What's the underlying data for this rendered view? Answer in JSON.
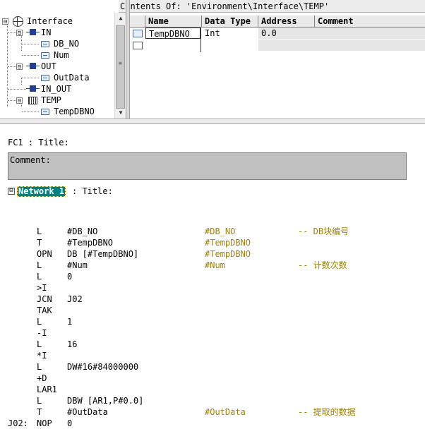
{
  "interface_tree": {
    "root": {
      "label": "Interface",
      "expander": "⊟",
      "icon": "globe-icon"
    },
    "items": [
      {
        "label": "IN",
        "expander": "⊟",
        "icon": "in-param-icon",
        "level": 1
      },
      {
        "label": "DB_NO",
        "icon": "variable-icon",
        "level": 2
      },
      {
        "label": "Num",
        "icon": "variable-icon",
        "level": 2
      },
      {
        "label": "OUT",
        "expander": "⊟",
        "icon": "out-param-icon",
        "level": 1
      },
      {
        "label": "OutData",
        "icon": "variable-icon",
        "level": 2
      },
      {
        "label": "IN_OUT",
        "icon": "inout-param-icon",
        "level": 1
      },
      {
        "label": "TEMP",
        "expander": "⊟",
        "icon": "temp-icon",
        "level": 1
      },
      {
        "label": "TempDBNO",
        "icon": "variable-icon",
        "level": 2
      }
    ]
  },
  "contents_title": "Contents Of: 'Environment\\Interface\\TEMP'",
  "var_table": {
    "headers": {
      "name": "Name",
      "data_type": "Data Type",
      "address": "Address",
      "comment": "Comment"
    },
    "rows": [
      {
        "name": "TempDBNO",
        "data_type": "Int",
        "address": "0.0",
        "comment": ""
      }
    ]
  },
  "editor": {
    "block_title": "FC1 : Title:",
    "comment_label": "Comment:",
    "network": {
      "expander": "⊟",
      "label": "Network 1",
      "title": ": Title:"
    },
    "code": [
      {
        "label": "",
        "op": "L",
        "arg": "#DB_NO",
        "sym": "#DB_NO",
        "cmt": "-- DB块编号"
      },
      {
        "label": "",
        "op": "T",
        "arg": "#TempDBNO",
        "sym": "#TempDBNO",
        "cmt": ""
      },
      {
        "label": "",
        "op": "OPN",
        "arg": "DB [#TempDBNO]",
        "sym": "#TempDBNO",
        "cmt": ""
      },
      {
        "label": "",
        "op": "L",
        "arg": "#Num",
        "sym": "#Num",
        "cmt": "-- 计数次数"
      },
      {
        "label": "",
        "op": "L",
        "arg": "0",
        "sym": "",
        "cmt": ""
      },
      {
        "label": "",
        "op": ">I",
        "arg": "",
        "sym": "",
        "cmt": ""
      },
      {
        "label": "",
        "op": "JCN",
        "arg": "J02",
        "sym": "",
        "cmt": ""
      },
      {
        "label": "",
        "op": "TAK",
        "arg": "",
        "sym": "",
        "cmt": ""
      },
      {
        "label": "",
        "op": "L",
        "arg": "1",
        "sym": "",
        "cmt": ""
      },
      {
        "label": "",
        "op": "-I",
        "arg": "",
        "sym": "",
        "cmt": ""
      },
      {
        "label": "",
        "op": "L",
        "arg": "16",
        "sym": "",
        "cmt": ""
      },
      {
        "label": "",
        "op": "*I",
        "arg": "",
        "sym": "",
        "cmt": ""
      },
      {
        "label": "",
        "op": "L",
        "arg": "DW#16#84000000",
        "sym": "",
        "cmt": ""
      },
      {
        "label": "",
        "op": "+D",
        "arg": "",
        "sym": "",
        "cmt": ""
      },
      {
        "label": "",
        "op": "LAR1",
        "arg": "",
        "sym": "",
        "cmt": ""
      },
      {
        "label": "",
        "op": "L",
        "arg": "DBW [AR1,P#0.0]",
        "sym": "",
        "cmt": ""
      },
      {
        "label": "",
        "op": "T",
        "arg": "#OutData",
        "sym": "#OutData",
        "cmt": "-- 提取的数据"
      },
      {
        "label": "J02:",
        "op": "NOP",
        "arg": "0",
        "sym": "",
        "cmt": ""
      }
    ]
  },
  "colors": {
    "network_highlight": "#008080",
    "symbol_text": "#a0820a",
    "comment_box": "#c0c0c0"
  }
}
